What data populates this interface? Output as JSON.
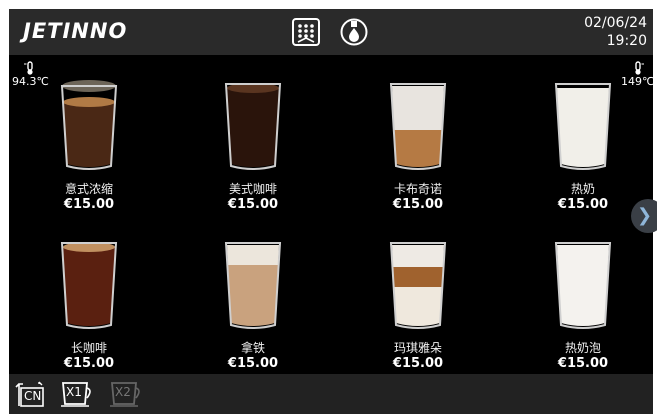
{
  "brand": {
    "logo_text": "JETINNO"
  },
  "header": {
    "date": "02/06/24",
    "time": "19:20",
    "icons": [
      "menu-grid-icon",
      "water-drop-icon"
    ]
  },
  "status": {
    "left_temp": "94.3℃",
    "right_temp": "149℃"
  },
  "drinks": [
    {
      "name": "意式浓缩",
      "price": "€15.00",
      "style": "espresso"
    },
    {
      "name": "美式咖啡",
      "price": "€15.00",
      "style": "americano"
    },
    {
      "name": "卡布奇诺",
      "price": "€15.00",
      "style": "cappuccino"
    },
    {
      "name": "热奶",
      "price": "€15.00",
      "style": "hot-milk"
    },
    {
      "name": "长咖啡",
      "price": "€15.00",
      "style": "long-coffee"
    },
    {
      "name": "拿铁",
      "price": "€15.00",
      "style": "latte"
    },
    {
      "name": "玛琪雅朵",
      "price": "€15.00",
      "style": "macchiato"
    },
    {
      "name": "热奶泡",
      "price": "€15.00",
      "style": "milk-foam"
    }
  ],
  "bottom": {
    "lang_label": "CN",
    "x1_label": "X1",
    "x2_label": "X2"
  },
  "colors": {
    "topbar": "#2a2a2a",
    "bottombar": "#222222",
    "next_button": "#3a3f46"
  }
}
